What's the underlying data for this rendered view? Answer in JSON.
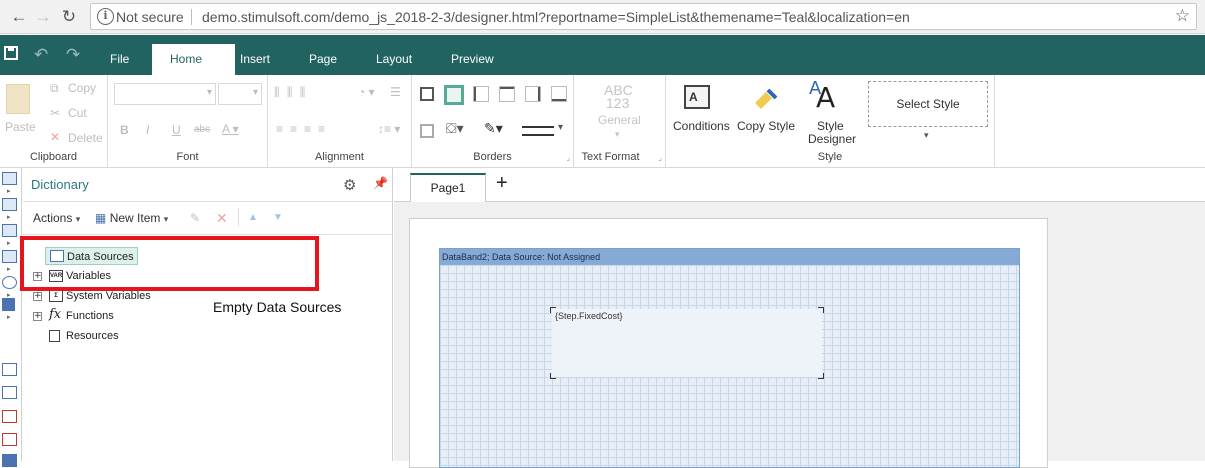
{
  "browser": {
    "security": "Not secure",
    "url": "demo.stimulsoft.com/demo_js_2018-2-3/designer.html?reportname=SimpleList&themename=Teal&localization=en"
  },
  "menu_tabs": [
    "File",
    "Home",
    "Insert",
    "Page",
    "Layout",
    "Preview"
  ],
  "active_tab": "Home",
  "ribbon": {
    "clipboard": {
      "paste": "Paste",
      "copy": "Copy",
      "cut": "Cut",
      "delete": "Delete",
      "label": "Clipboard"
    },
    "font": {
      "label": "Font"
    },
    "alignment": {
      "label": "Alignment"
    },
    "borders": {
      "label": "Borders"
    },
    "text_format": {
      "sample1": "ABC",
      "sample2": "123",
      "format": "General",
      "label": "Text Format"
    },
    "style": {
      "conditions": "Conditions",
      "copy_style": "Copy Style",
      "style_designer_1": "Style",
      "style_designer_2": "Designer",
      "select_style": "Select Style",
      "label": "Style"
    }
  },
  "dictionary": {
    "title": "Dictionary",
    "actions": "Actions",
    "new_item": "New Item",
    "tree": [
      {
        "label": "Data Sources"
      },
      {
        "label": "Variables"
      },
      {
        "label": "System Variables"
      },
      {
        "label": "Functions"
      },
      {
        "label": "Resources"
      }
    ]
  },
  "annotation": "Empty Data Sources",
  "designer": {
    "page_tab": "Page1",
    "add_tab": "+",
    "band_header": "DataBand2; Data Source: Not Assigned",
    "textbox": "{Step.FixedCost}"
  },
  "colors": {
    "accent": "#216360",
    "highlight": "#e5141d",
    "band": "#86aad6"
  }
}
